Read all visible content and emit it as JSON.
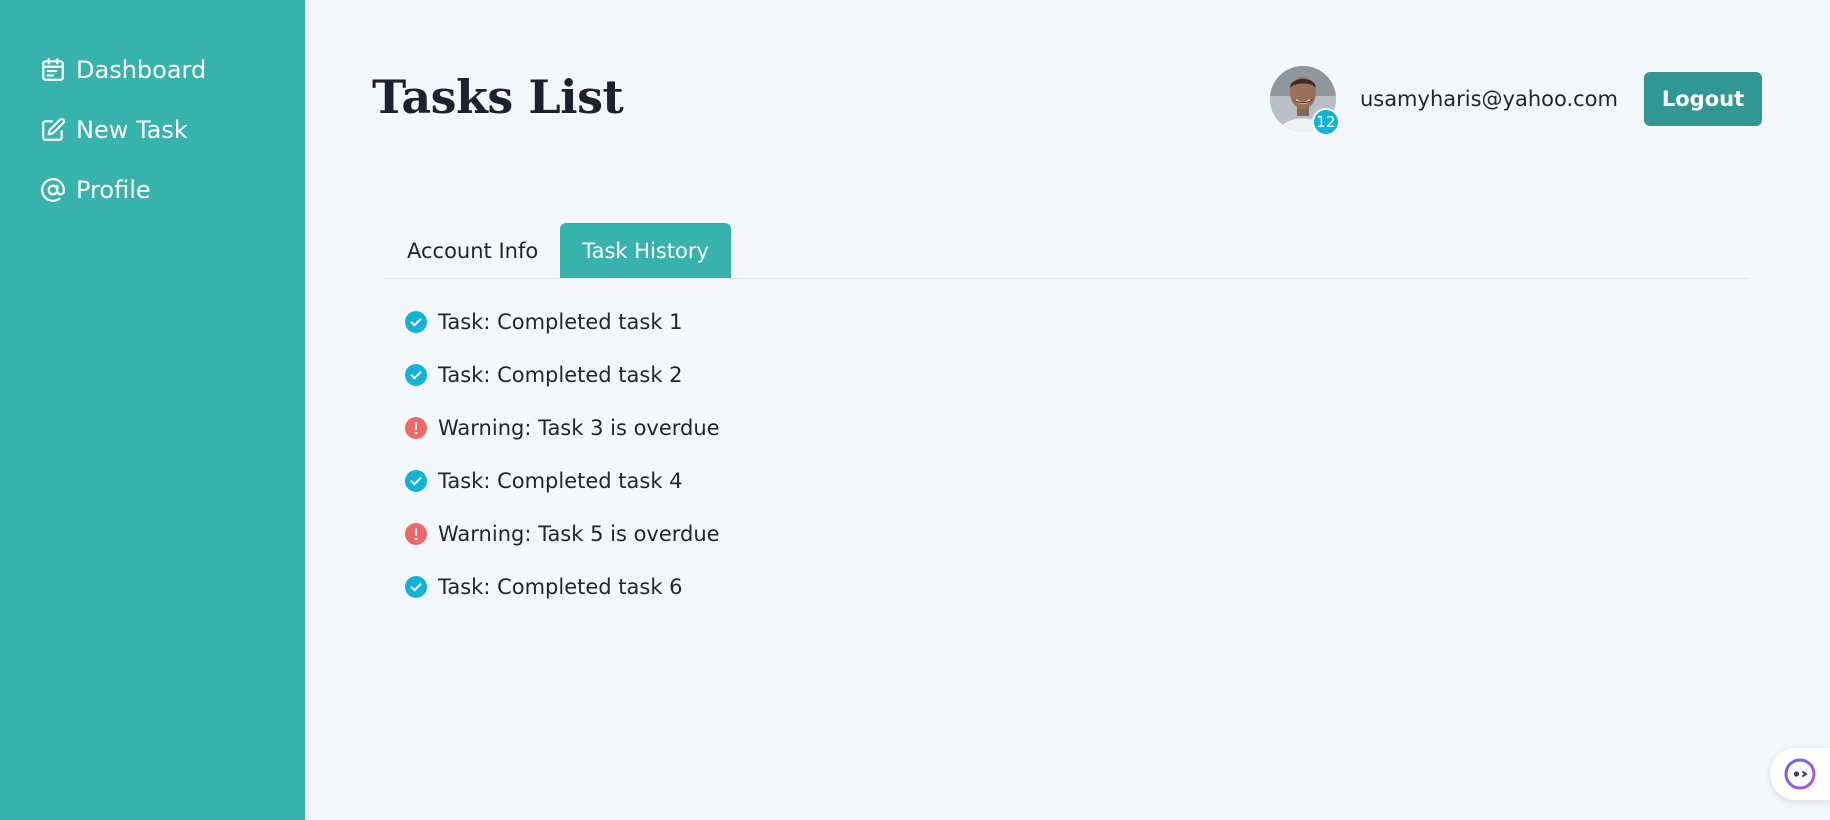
{
  "sidebar": {
    "items": [
      {
        "label": "Dashboard",
        "icon": "calendar-icon"
      },
      {
        "label": "New Task",
        "icon": "edit-icon"
      },
      {
        "label": "Profile",
        "icon": "at-icon"
      }
    ]
  },
  "header": {
    "title": "Tasks List",
    "user_email": "usamyharis@yahoo.com",
    "avatar_badge": "12",
    "logout_label": "Logout"
  },
  "tabs": [
    {
      "label": "Account Info",
      "active": false
    },
    {
      "label": "Task History",
      "active": true
    }
  ],
  "history": [
    {
      "text": "Task: Completed task 1",
      "status": "completed",
      "icon": "check-circle-icon"
    },
    {
      "text": "Task: Completed task 2",
      "status": "completed",
      "icon": "check-circle-icon"
    },
    {
      "text": "Warning: Task 3 is overdue",
      "status": "warning",
      "icon": "warning-circle-icon"
    },
    {
      "text": "Task: Completed task 4",
      "status": "completed",
      "icon": "check-circle-icon"
    },
    {
      "text": "Warning: Task 5 is overdue",
      "status": "warning",
      "icon": "warning-circle-icon"
    },
    {
      "text": "Task: Completed task 6",
      "status": "completed",
      "icon": "check-circle-icon"
    }
  ],
  "colors": {
    "sidebar": "#38b2ac",
    "accent": "#319795",
    "completed": "#11b3d6",
    "warning": "#ef6767",
    "badge": "#11b3d6"
  }
}
